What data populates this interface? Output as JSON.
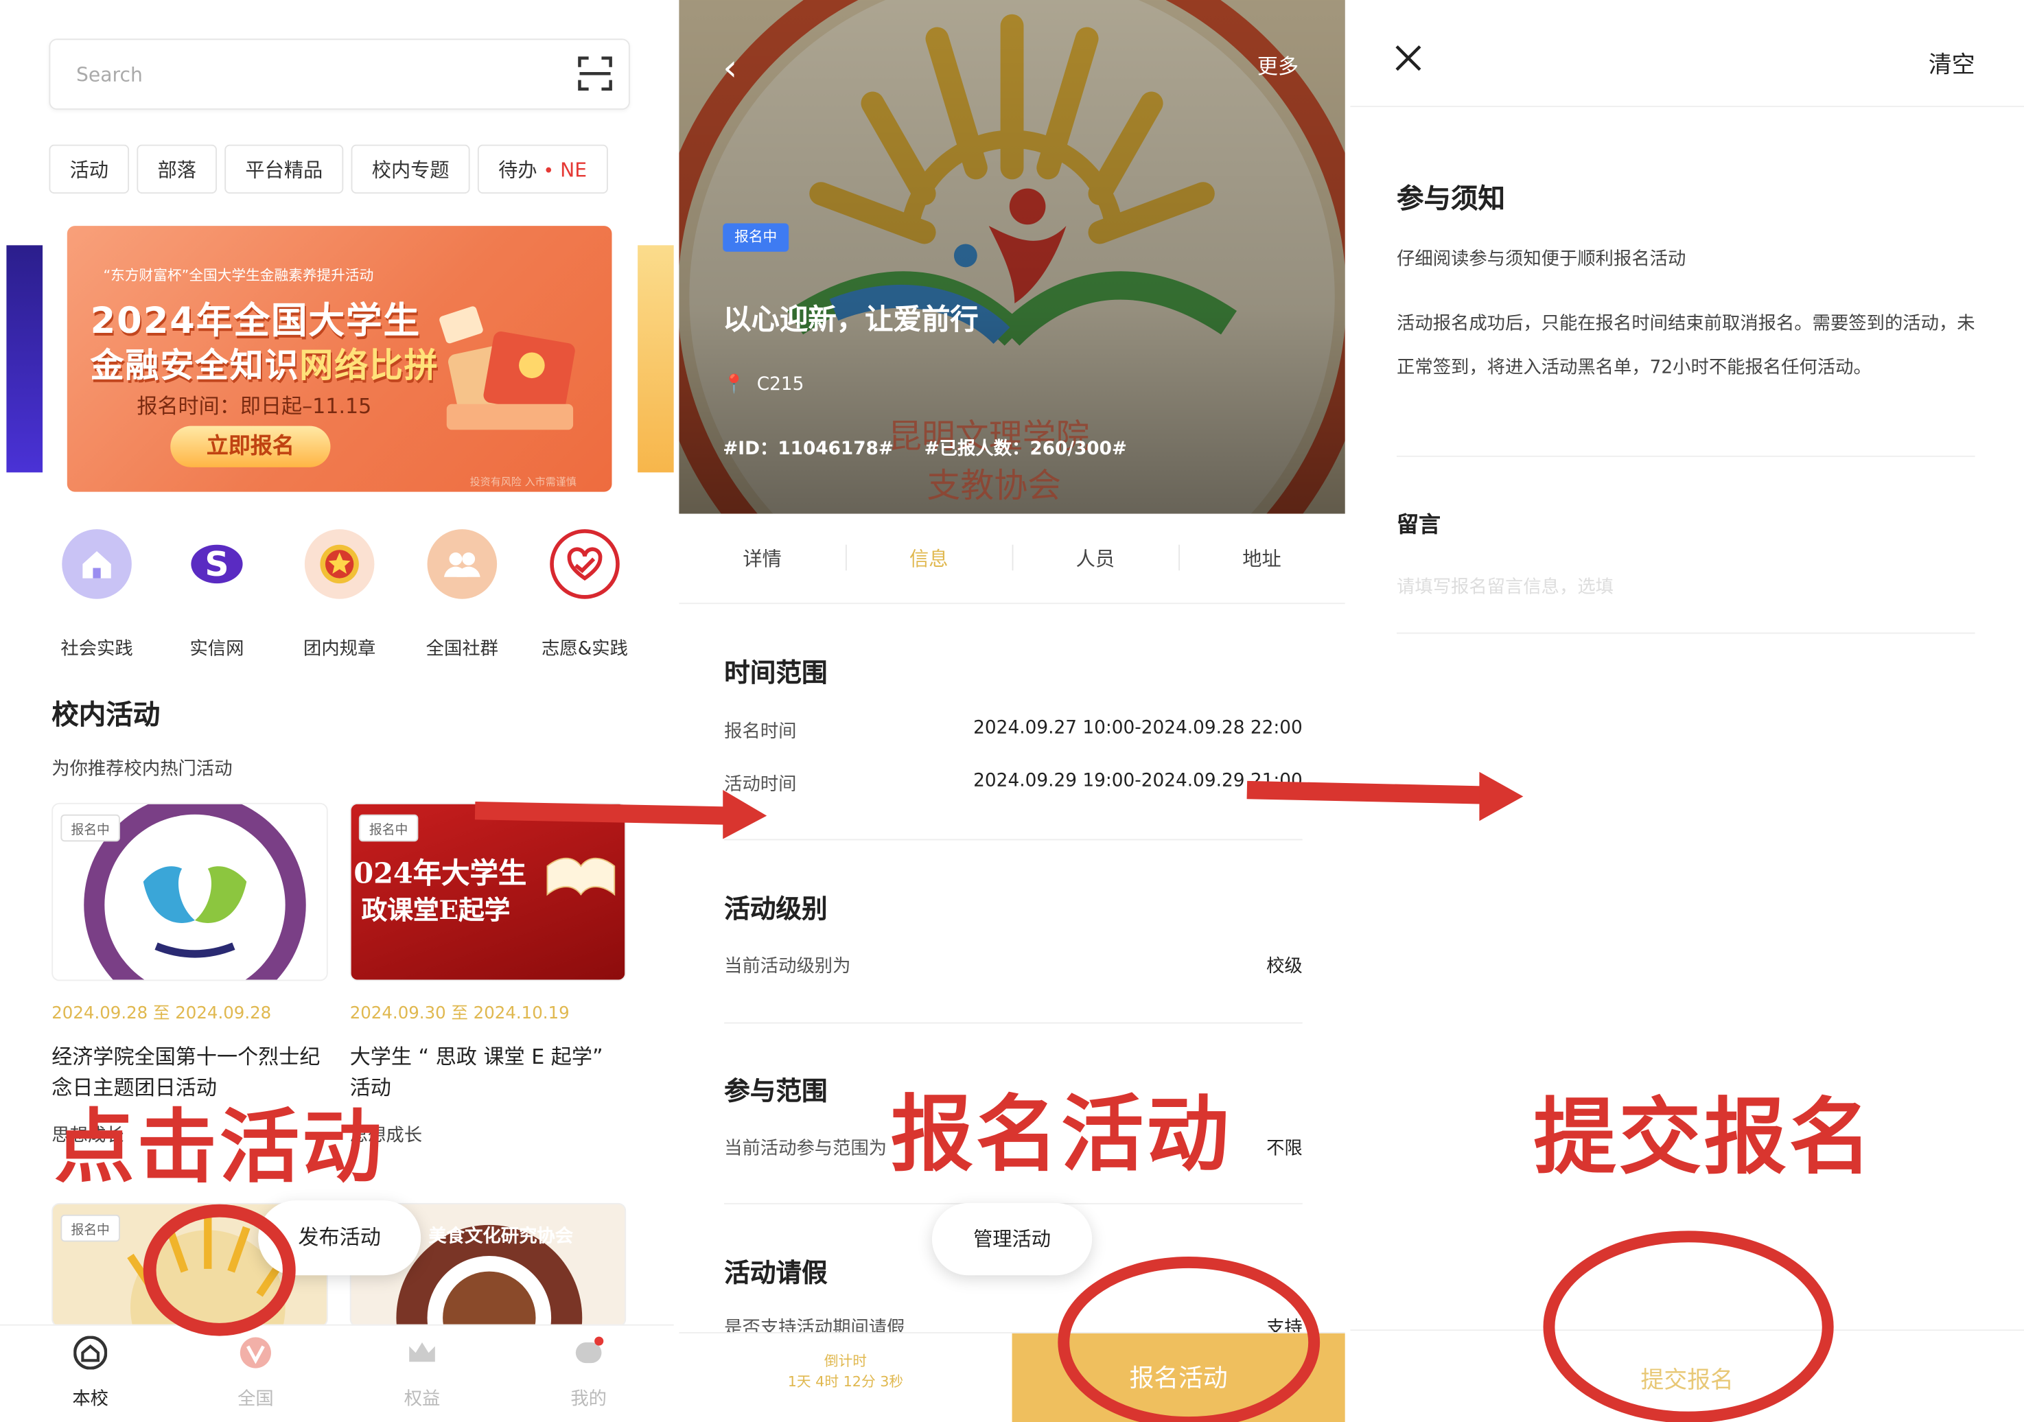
{
  "panel1": {
    "search_placeholder": "Search",
    "tabs": [
      "活动",
      "部落",
      "平台精品",
      "校内专题",
      "待办"
    ],
    "tab_badge": "NE",
    "banner": {
      "sub": "“东方财富杯”全国大学生金融素养提升活动",
      "line1": "2024年全国大学生",
      "line2a": "金融安全知识",
      "line2b": "网络比拼",
      "time": "报名时间：即日起–11.15",
      "button": "立即报名",
      "fine": "投资有风险 入市需谨慎"
    },
    "quick_icons": [
      {
        "label": "社会实践",
        "icon": "house-icon"
      },
      {
        "label": "实信网",
        "icon": "s-logo-icon"
      },
      {
        "label": "团内规章",
        "icon": "league-badge-icon"
      },
      {
        "label": "全国社群",
        "icon": "group-icon"
      },
      {
        "label": "志愿&实践",
        "icon": "heart-hand-icon"
      }
    ],
    "section_title": "校内活动",
    "section_subtitle": "为你推荐校内热门活动",
    "cards": [
      {
        "tag": "报名中",
        "date": "2024.09.28 至 2024.09.28",
        "title": "经济学院全国第十一个烈士纪念日主题团日活动",
        "category": "思想成长"
      },
      {
        "tag": "报名中",
        "date": "2024.09.30 至 2024.10.19",
        "title": "大学生 “ 思政 课堂 E 起学” 活动",
        "category": "思想成长",
        "image_text_1": "024年大学生",
        "image_text_2": "政课堂E起学"
      }
    ],
    "card3_tag": "报名中",
    "card4_text": "美食文化研究协会",
    "fab": "发布活动",
    "nav": [
      {
        "label": "本校",
        "icon": "home-icon",
        "active": true
      },
      {
        "label": "全国",
        "icon": "v-logo-icon",
        "active": false
      },
      {
        "label": "权益",
        "icon": "crown-icon",
        "active": false
      },
      {
        "label": "我的",
        "icon": "chat-bubble-icon",
        "active": false
      }
    ]
  },
  "panel2": {
    "more": "更多",
    "badge": "报名中",
    "title": "以心迎新，让爱前行",
    "location": "C215",
    "id_text": "#ID：11046178#",
    "count_text": "#已报人数：260/300#",
    "hero_watermark_1": "昆明文理学院",
    "hero_watermark_2": "支教协会",
    "tabs": [
      "详情",
      "信息",
      "人员",
      "地址"
    ],
    "active_tab": "信息",
    "sections": {
      "time_title": "时间范围",
      "signup_label": "报名时间",
      "signup_value": "2024.09.27 10:00-2024.09.28 22:00",
      "event_label": "活动时间",
      "event_value": "2024.09.29 19:00-2024.09.29 21:00",
      "level_title": "活动级别",
      "level_label": "当前活动级别为",
      "level_value": "校级",
      "scope_title": "参与范围",
      "scope_label": "当前活动参与范围为",
      "scope_value": "不限",
      "leave_title": "活动请假",
      "leave_label": "是否支持活动期间请假",
      "leave_value": "支持"
    },
    "fab": "管理活动",
    "countdown_label": "倒计时",
    "countdown_value": "1天 4时 12分 3秒",
    "signup_button": "报名活动"
  },
  "panel3": {
    "clear": "清空",
    "heading": "参与须知",
    "subheading": "仔细阅读参与须知便于顺利报名活动",
    "notice": "活动报名成功后，只能在报名时间结束前取消报名。需要签到的活动，未正常签到，将进入活动黑名单，72小时不能报名任何活动。",
    "message_title": "留言",
    "message_placeholder": "请填写报名留言信息，选填",
    "submit": "提交报名"
  },
  "annotations": {
    "click_activity": "点击活动",
    "signup_activity": "报名活动",
    "submit_signup": "提交报名",
    "color": "#d9352f"
  },
  "colors": {
    "accent_gold": "#efbf5e",
    "date_gold": "#e0b84f",
    "badge_blue": "#3e7bf2",
    "annotation_red": "#d9352f"
  }
}
